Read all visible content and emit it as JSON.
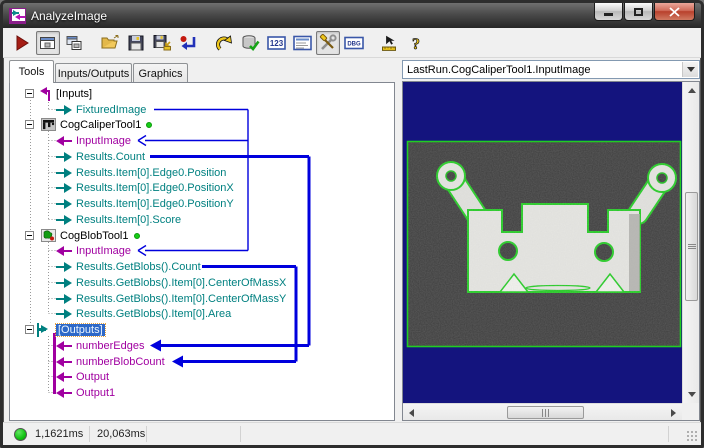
{
  "window": {
    "title": "AnalyzeImage"
  },
  "window_controls": {
    "minimize": "minimize",
    "maximize": "maximize",
    "close": "close"
  },
  "toolbar": {
    "buttons": [
      {
        "name": "run",
        "pressed": false
      },
      {
        "name": "show-tool-windows",
        "pressed": true
      },
      {
        "name": "copy-tool-window",
        "pressed": false
      },
      {
        "name": "open",
        "pressed": false
      },
      {
        "name": "save",
        "pressed": false
      },
      {
        "name": "save-as",
        "pressed": false
      },
      {
        "name": "revert",
        "pressed": false
      },
      {
        "name": "undo",
        "pressed": false
      },
      {
        "name": "database-check",
        "pressed": false
      },
      {
        "name": "numeric-results",
        "pressed": false
      },
      {
        "name": "list-view",
        "pressed": false
      },
      {
        "name": "job-tools",
        "pressed": true
      },
      {
        "name": "debug",
        "pressed": false
      },
      {
        "name": "pointer-measure",
        "pressed": false
      },
      {
        "name": "help",
        "pressed": false
      }
    ],
    "icon_123_text": "123",
    "icon_dbg_text": "DBG"
  },
  "tabs": [
    {
      "label": "Tools",
      "active": true
    },
    {
      "label": "Inputs/Outputs",
      "active": false
    },
    {
      "label": "Graphics",
      "active": false
    }
  ],
  "tree": {
    "nodes": [
      {
        "label": "[Inputs]",
        "type": "input-group",
        "children": [
          {
            "label": "FixturedImage",
            "direction": "out"
          }
        ]
      },
      {
        "label": "CogCaliperTool1",
        "type": "caliper-tool",
        "status_dot": "green",
        "children": [
          {
            "label": "InputImage",
            "direction": "in"
          },
          {
            "label": "Results.Count",
            "direction": "out"
          },
          {
            "label": "Results.Item[0].Edge0.Position",
            "direction": "out"
          },
          {
            "label": "Results.Item[0].Edge0.PositionX",
            "direction": "out"
          },
          {
            "label": "Results.Item[0].Edge0.PositionY",
            "direction": "out"
          },
          {
            "label": "Results.Item[0].Score",
            "direction": "out"
          }
        ]
      },
      {
        "label": "CogBlobTool1",
        "type": "blob-tool",
        "status_dot": "green",
        "children": [
          {
            "label": "InputImage",
            "direction": "in"
          },
          {
            "label": "Results.GetBlobs().Count",
            "direction": "out"
          },
          {
            "label": "Results.GetBlobs().Item[0].CenterOfMassX",
            "direction": "out"
          },
          {
            "label": "Results.GetBlobs().Item[0].CenterOfMassY",
            "direction": "out"
          },
          {
            "label": "Results.GetBlobs().Item[0].Area",
            "direction": "out"
          }
        ]
      },
      {
        "label": "[Outputs]",
        "type": "output-group",
        "selected": true,
        "children": [
          {
            "label": "numberEdges",
            "direction": "in"
          },
          {
            "label": "numberBlobCount",
            "direction": "in"
          },
          {
            "label": "Output",
            "direction": "in"
          },
          {
            "label": "Output1",
            "direction": "in"
          }
        ]
      }
    ],
    "connections": [
      {
        "from": "FixturedImage",
        "to": "CogCaliperTool1.InputImage",
        "style": "thin"
      },
      {
        "from": "FixturedImage",
        "to": "CogBlobTool1.InputImage",
        "style": "thin"
      },
      {
        "from": "CogCaliperTool1.Results.Count",
        "to": "numberEdges",
        "style": "thick"
      },
      {
        "from": "CogBlobTool1.Results.GetBlobs().Count",
        "to": "numberBlobCount",
        "style": "thick"
      }
    ]
  },
  "image_view": {
    "selector": "LastRun.CogCaliperTool1.InputImage"
  },
  "status": {
    "time_a": "1,1621ms",
    "time_b": "20,063ms",
    "indicator": "green"
  },
  "colors": {
    "connector_blue": "#0000dd",
    "port_in_magenta": "#a000a0",
    "port_out_teal": "#008080",
    "run_dot_green": "#17cc17",
    "selection_blue": "#2d68c8",
    "image_background_navy": "#14147e",
    "roi_green": "#22cc22"
  }
}
